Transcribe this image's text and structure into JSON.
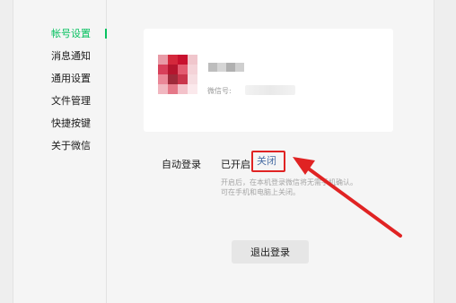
{
  "sidebar": {
    "items": [
      {
        "label": "帐号设置",
        "active": true
      },
      {
        "label": "消息通知",
        "active": false
      },
      {
        "label": "通用设置",
        "active": false
      },
      {
        "label": "文件管理",
        "active": false
      },
      {
        "label": "快捷按键",
        "active": false
      },
      {
        "label": "关于微信",
        "active": false
      }
    ]
  },
  "account": {
    "wechat_id_label": "微信号:",
    "avatar_icon": "blurred-avatar",
    "name_icon": "blurred-nickname"
  },
  "auto_login": {
    "label": "自动登录",
    "status": "已开启",
    "close_link": "关闭",
    "hint_line1": "开启后，在本机登录微信将无需手机确认。",
    "hint_line2": "可在手机和电脑上关闭。"
  },
  "logout": {
    "label": "退出登录"
  },
  "annotation": {
    "arrow_color": "#e02323",
    "box_color": "#e02323"
  },
  "colors": {
    "accent": "#07c160",
    "link": "#4a6fa5"
  }
}
